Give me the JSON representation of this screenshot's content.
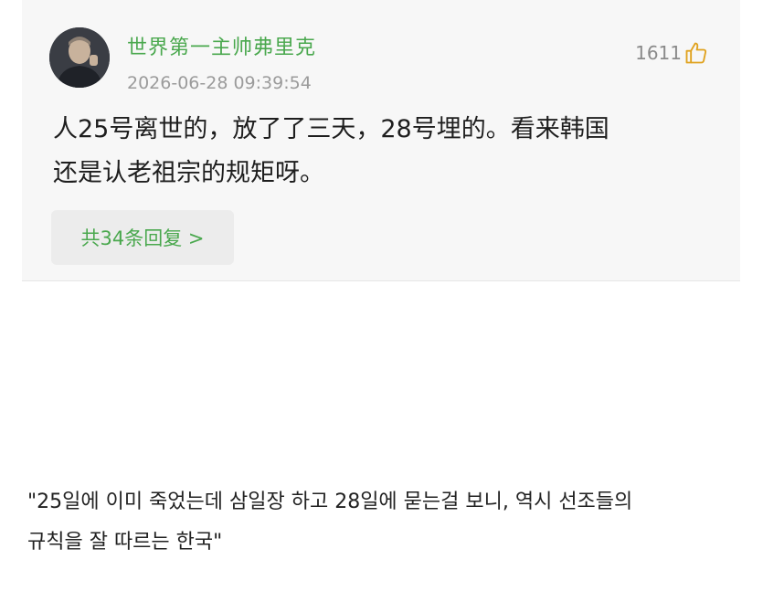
{
  "comment": {
    "username": "世界第一主帅弗里克",
    "timestamp": "2026-06-28 09:39:54",
    "like_count": "1611",
    "like_icon": "thumbs-up-icon",
    "text_line1": "人25号离世的，放了了三天，28号埋的。看来韩国",
    "text_line2": "还是认老祖宗的规矩呀。",
    "replies_label": "共34条回复 >"
  },
  "translation": {
    "line1": "\"25일에 이미 죽었는데 삼일장 하고 28일에 묻는걸 보니, 역시 선조들의",
    "line2": "규칙을 잘 따르는 한국\""
  },
  "colors": {
    "accent_green": "#4aa84e",
    "card_bg": "#f7f7f7",
    "meta_gray": "#9b9b9b"
  }
}
